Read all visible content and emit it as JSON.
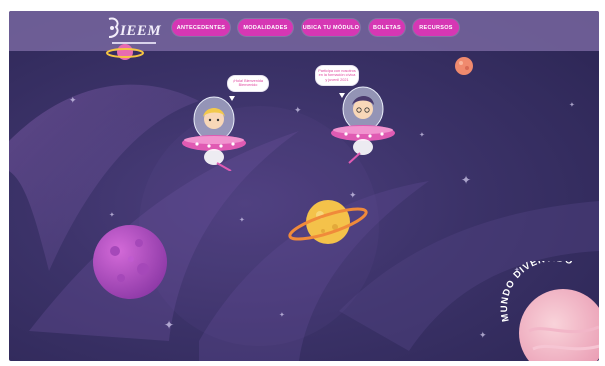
{
  "header": {
    "logo_text": "IEEM",
    "menu": [
      {
        "label": "ANTECEDENTES"
      },
      {
        "label": "MODALIDADES"
      },
      {
        "label": "UBICA TU MÓDULO"
      },
      {
        "label": "BOLETAS"
      },
      {
        "label": "RECURSOS"
      }
    ]
  },
  "scene": {
    "bubble_left": "¡Hola! Bienvenida Bienvenido",
    "bubble_right": "Participa con nosotros en la formación cívica y juvenil 2021",
    "badge": "MUNDO DIVERTIDO"
  },
  "colors": {
    "nav_bg": "#7d6ca5",
    "menu_button": "#d637b4",
    "space_bg": "#3b3268",
    "planet_purple": "#b34fc4",
    "planet_yellow": "#f4c24a",
    "planet_pink": "#f2b6c8"
  }
}
